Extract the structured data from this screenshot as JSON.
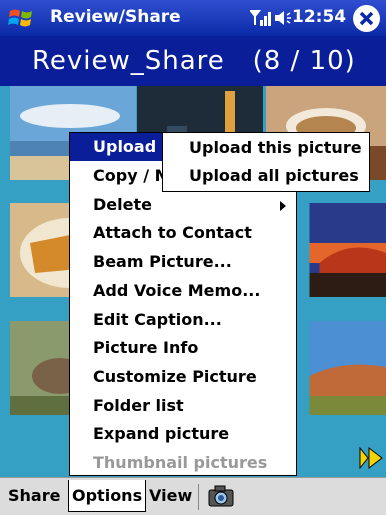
{
  "titlebar": {
    "app_title": "Review/Share",
    "clock": "12:54",
    "icons": {
      "start": "windows-flag-icon",
      "signal": "signal-icon",
      "volume": "speaker-icon",
      "close": "close-icon"
    }
  },
  "header": {
    "title": "Review_Share",
    "counter": "(8 / 10)"
  },
  "menu": {
    "items": [
      {
        "label": "Upload",
        "active": true
      },
      {
        "label": "Copy / M",
        "active": false
      },
      {
        "label": "Delete",
        "has_submenu": true
      },
      {
        "label": "Attach to Contact"
      },
      {
        "label": "Beam Picture..."
      },
      {
        "label": "Add Voice Memo..."
      },
      {
        "label": "Edit Caption..."
      },
      {
        "label": "Picture Info"
      },
      {
        "label": "Customize Picture"
      },
      {
        "label": "Folder list"
      },
      {
        "label": "Expand picture"
      },
      {
        "label": "Thumbnail pictures",
        "disabled": true
      }
    ]
  },
  "submenu": {
    "items": [
      {
        "label": "Upload this picture"
      },
      {
        "label": "Upload all pictures"
      }
    ]
  },
  "bottombar": {
    "share": "Share",
    "options": "Options",
    "view": "View",
    "camera_icon": "camera-icon"
  },
  "colors": {
    "titlebar": "#0a2aa8",
    "header": "#0a1e9a",
    "grid_bg": "#36a0c4",
    "selection": "#0a1e9a",
    "next_arrow": "#f5d400"
  }
}
